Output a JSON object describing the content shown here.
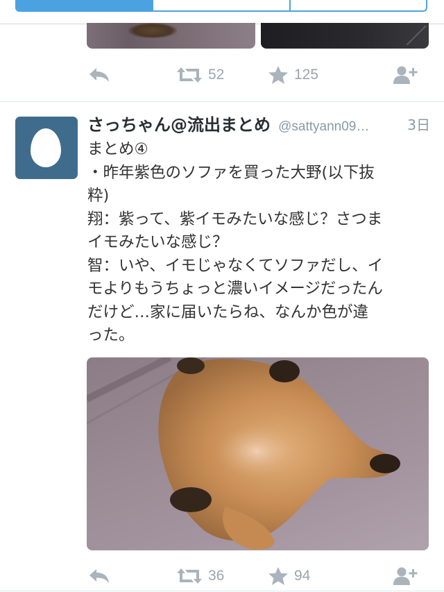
{
  "colors": {
    "accent": "#4aa3e0",
    "action_icon": "#a9b4bc",
    "avatar_bg": "#3f6c8d",
    "name": "#292f33",
    "meta": "#8899a6"
  },
  "previous_tweet": {
    "retweets": "52",
    "favorites": "125"
  },
  "tweet": {
    "author_name": "さっちゃん@流出まとめ",
    "handle": "@sattyann09…",
    "time": "3日",
    "lines": [
      "まとめ④",
      "・昨年紫色のソファを買った大野(以下抜",
      "粋)",
      "翔：紫って、紫イモみたいな感じ？さつま",
      "イモみたいな感じ？",
      "智：いや、イモじゃなくてソファだし、イ",
      "モよりもうちょっと濃いイメージだったん",
      "だけど…家に届いたらね、なんか色が違",
      "った。"
    ],
    "retweets": "36",
    "favorites": "94"
  },
  "icons": {
    "reply": "reply-icon",
    "retweet": "retweet-icon",
    "favorite": "star-icon",
    "follow": "follow-icon",
    "avatar": "egg-avatar-icon"
  }
}
